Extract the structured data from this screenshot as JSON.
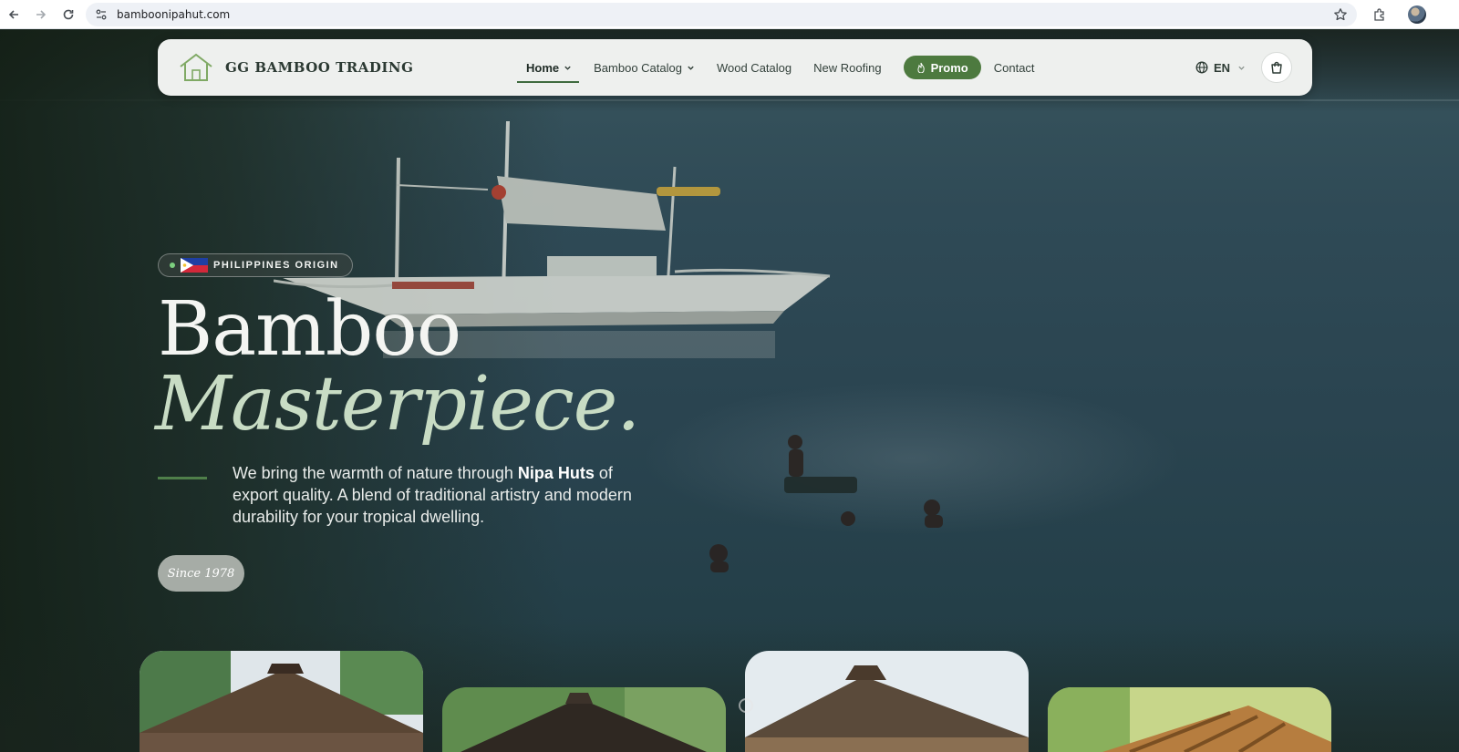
{
  "browser": {
    "url": "bamboonipahut.com"
  },
  "navbar": {
    "brand": "GG BAMBOO TRADING",
    "items": [
      {
        "label": "Home",
        "active": true,
        "has_dropdown": true
      },
      {
        "label": "Bamboo Catalog",
        "active": false,
        "has_dropdown": true
      },
      {
        "label": "Wood Catalog",
        "active": false,
        "has_dropdown": false
      },
      {
        "label": "New Roofing",
        "active": false,
        "has_dropdown": false
      },
      {
        "label": "Contact",
        "active": false,
        "has_dropdown": false
      }
    ],
    "promo_label": "Promo",
    "language": "EN",
    "icons": [
      "house-logo-icon",
      "chevron-down-icon",
      "fire-icon",
      "globe-icon",
      "shopping-bag-icon"
    ]
  },
  "hero": {
    "badge": "PHILIPPINES ORIGIN",
    "title_line1": "Bamboo",
    "title_line2": "Masterpiece.",
    "description_pre": "We bring the warmth of nature through ",
    "description_bold": "Nipa Huts",
    "description_post": " of export quality. A blend of traditional artistry and modern durability for your tropical dwelling.",
    "since_label": "Since 1978"
  },
  "colors": {
    "accent_green": "#4d7a3f",
    "title_italic": "#c8dcc4",
    "navbar_bg": "#eef0ee"
  }
}
